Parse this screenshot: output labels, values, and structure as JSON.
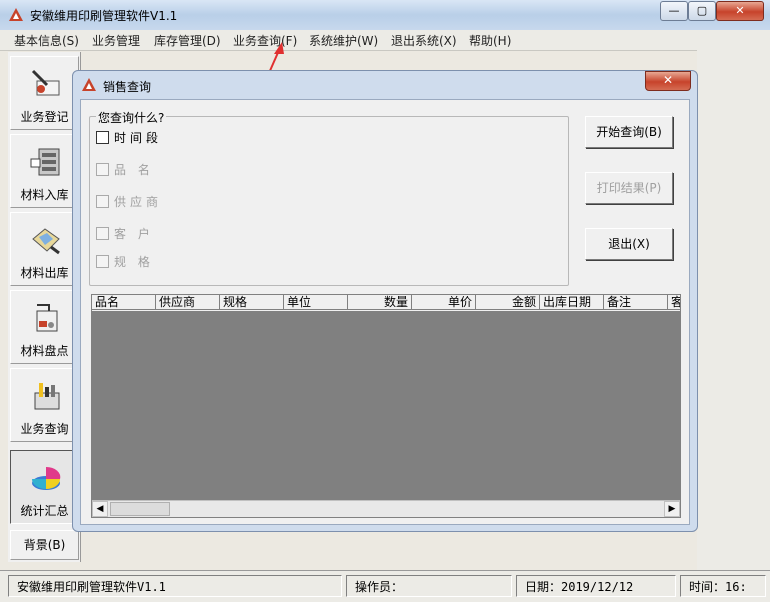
{
  "window": {
    "title": "安徽维用印刷管理软件V1.1",
    "min": "—",
    "max": "▢",
    "close": "✕"
  },
  "menu": [
    "基本信息(S)",
    "业务管理",
    "库存管理(D)",
    "业务查询(F)",
    "系统维护(W)",
    "退出系统(X)",
    "帮助(H)"
  ],
  "toolbar": {
    "items": [
      {
        "label": "业务登记",
        "icon": "register-icon"
      },
      {
        "label": "材料入库",
        "icon": "warehouse-in-icon"
      },
      {
        "label": "材料出库",
        "icon": "warehouse-out-icon"
      },
      {
        "label": "材料盘点",
        "icon": "inventory-icon"
      },
      {
        "label": "业务查询",
        "icon": "query-icon"
      },
      {
        "label": "统计汇总",
        "icon": "pie-chart-icon"
      }
    ],
    "background_label": "背景(B)"
  },
  "dialog": {
    "title": "销售查询",
    "close": "✕",
    "group_label": "您查询什么?",
    "checkboxes": [
      {
        "label": "时间段"
      },
      {
        "label": "品 名"
      },
      {
        "label": "供应商"
      },
      {
        "label": "客 户"
      },
      {
        "label": "规 格"
      }
    ],
    "buttons": {
      "start": "开始查询(B)",
      "print": "打印结果(P)",
      "exit": "退出(X)"
    },
    "grid": {
      "columns": [
        "品名",
        "供应商",
        "规格",
        "单位",
        "数量",
        "单价",
        "金额",
        "出库日期",
        "备注",
        "客"
      ]
    }
  },
  "status": {
    "app": "安徽维用印刷管理软件V1.1",
    "operator": "操作员：",
    "date": "日期：2019/12/12",
    "time": "时间：16:"
  },
  "colors": {
    "accent_red": "#c7432b",
    "dialog_frame": "#cfdced",
    "grid_bg": "#808080"
  }
}
